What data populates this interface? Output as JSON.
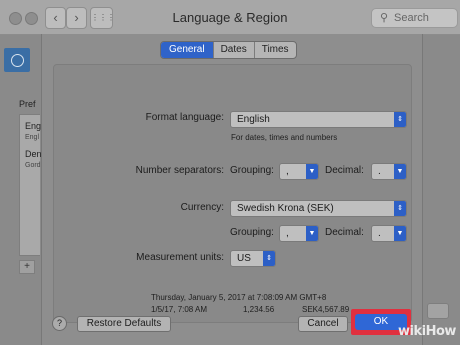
{
  "window": {
    "title": "Language & Region",
    "search_placeholder": "Search",
    "back_icon": "‹",
    "forward_icon": "›",
    "grid_icon": "⋮⋮⋮"
  },
  "background": {
    "preferred_label": "Pref",
    "list_items": [
      {
        "label": "Eng",
        "sub": "Engl"
      },
      {
        "label": "Den",
        "sub": "Gord"
      }
    ],
    "add_button": "+"
  },
  "sheet": {
    "tabs": [
      {
        "label": "General",
        "active": true
      },
      {
        "label": "Dates",
        "active": false
      },
      {
        "label": "Times",
        "active": false
      }
    ],
    "format_language": {
      "label": "Format language:",
      "value": "English",
      "hint": "For dates, times and numbers"
    },
    "number_separators": {
      "label": "Number separators:",
      "grouping_label": "Grouping:",
      "grouping_value": ",",
      "decimal_label": "Decimal:",
      "decimal_value": "."
    },
    "currency": {
      "label": "Currency:",
      "value": "Swedish Krona (SEK)",
      "grouping_label": "Grouping:",
      "grouping_value": ",",
      "decimal_label": "Decimal:",
      "decimal_value": "."
    },
    "measurement": {
      "label": "Measurement units:",
      "value": "US"
    },
    "samples": {
      "line1": "Thursday, January 5, 2017 at 7:08:09 AM GMT+8",
      "line2_date": "1/5/17, 7:08 AM",
      "line2_number": "1,234.56",
      "line2_currency": "SEK4,567.89"
    },
    "help_label": "?",
    "restore_label": "Restore Defaults",
    "cancel_label": "Cancel",
    "ok_label": "OK"
  },
  "watermark": "wikiHow",
  "colors": {
    "accent": "#2f63c9",
    "highlight": "#e0303f"
  }
}
